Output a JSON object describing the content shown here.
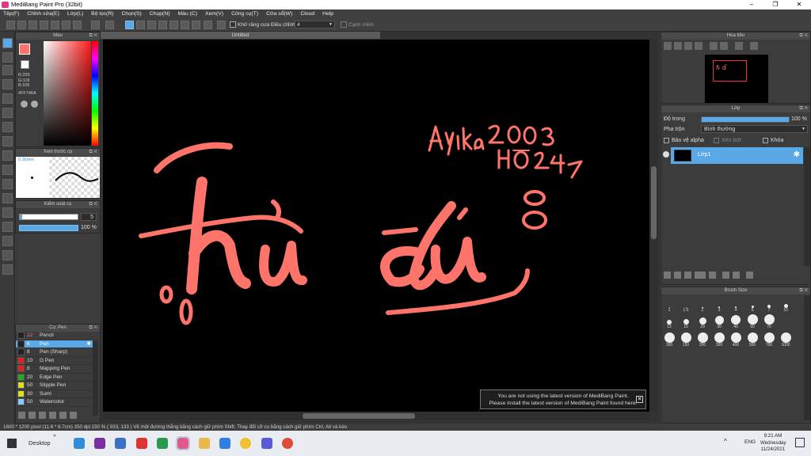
{
  "window": {
    "title": "MediBang Paint Pro (32bit)",
    "minimize": "–",
    "maximize": "❐",
    "close": "✕"
  },
  "menu": [
    "Tệp(F)",
    "Chỉnh sửa(E)",
    "Lớp(L)",
    "Bộ lọc(R)",
    "Chọn(S)",
    "Chụp(N)",
    "Màu (C)",
    "Xem(V)",
    "Công cụ(T)",
    "Cửa sổ(W)",
    "Cloud",
    "Help"
  ],
  "toolbar": {
    "antialias_label": "Khử răng cưa",
    "adjust_label": "Điều chỉnh",
    "adjust_value": "4",
    "edge_label": "Cạnh mềm"
  },
  "color_panel": {
    "title": "Màu",
    "r": "R:255",
    "g": "G:116",
    "b": "B:106",
    "hex": "#FF746A",
    "primary_color": "#FF746A"
  },
  "brush_preview": {
    "title": "Xem trước cọ",
    "size": "0.36mm"
  },
  "brush_control": {
    "title": "Kiểm soát cọ",
    "size_value": "5",
    "opacity_value": "100 %"
  },
  "brush_panel": {
    "title": "Cọ: Pen",
    "items": [
      {
        "size": "12",
        "name": "Pencil",
        "color": "#222222"
      },
      {
        "size": "6",
        "name": "Pen",
        "color": "#222222",
        "selected": true
      },
      {
        "size": "8",
        "name": "Pen (Sharp)",
        "color": "#222222"
      },
      {
        "size": "10",
        "name": "G Pen",
        "color": "#d22"
      },
      {
        "size": "8",
        "name": "Mapping Pen",
        "color": "#d22"
      },
      {
        "size": "20",
        "name": "Edge Pen",
        "color": "#2a2"
      },
      {
        "size": "50",
        "name": "Stipple Pen",
        "color": "#dd2"
      },
      {
        "size": "30",
        "name": "Sumi",
        "color": "#dd2"
      },
      {
        "size": "50",
        "name": "Watercolor",
        "color": "#8cf"
      }
    ]
  },
  "document": {
    "tab": "Untitled",
    "art_color": "#FF746A"
  },
  "notice": {
    "line1": "You are not using the latest version of MediBang Paint.",
    "line2": "Please install the latest version of MediBang Paint found here.",
    "close": "✕"
  },
  "navigator": {
    "title": "Hoa tiêu"
  },
  "layer_panel": {
    "title": "Lớp",
    "opacity_label": "Độ trong",
    "opacity_value": "100 %",
    "opacity_fraction": 1.0,
    "blend_label": "Pha trộn",
    "blend_value": "Bình thường",
    "protect_alpha": "Bảo vệ alpha",
    "clipping": "Xén bớt",
    "lock": "Khóa",
    "layer_name": "Lớp1"
  },
  "brush_size": {
    "title": "Brush Size",
    "sizes": [
      "1",
      "1.5",
      "2",
      "3",
      "4",
      "5",
      "7",
      "10",
      "12",
      "15",
      "20",
      "30",
      "40",
      "50",
      "70",
      "100",
      "150",
      "200",
      "300",
      "400",
      "500",
      "700",
      "1000"
    ]
  },
  "status": {
    "text": "1600 * 1200 pixel    (11.6 * 8.7cm)    350 dpi    150 %    ( 933, 133 )    Vẽ một đường thẳng bằng cách giữ phím Shift, Thay đổi cỡ cọ bằng cách giữ phím Ctrl, Alt và kéo"
  },
  "taskbar": {
    "desktop": "Desktop",
    "lang": "ENG",
    "time": "9:21 AM",
    "day": "Wednesday",
    "date": "11/24/2021"
  }
}
